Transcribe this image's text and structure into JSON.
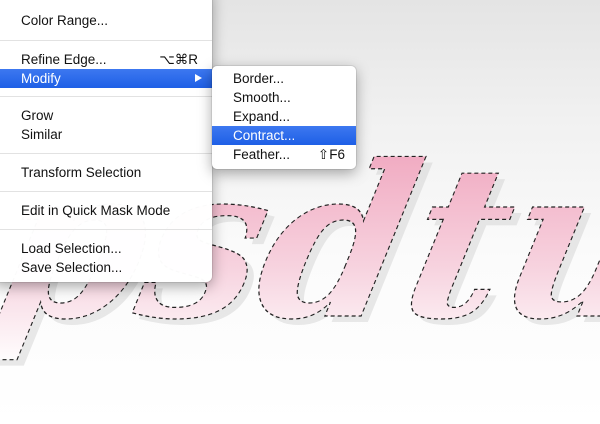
{
  "canvas": {
    "text": "psdtuts",
    "text_color": "#f3c6d3"
  },
  "menu": {
    "items": [
      {
        "label": "Color Range...",
        "shortcut": ""
      },
      {
        "label": "Refine Edge...",
        "shortcut": "⌥⌘R"
      },
      {
        "label": "Modify",
        "shortcut": ""
      },
      {
        "label": "Grow",
        "shortcut": ""
      },
      {
        "label": "Similar",
        "shortcut": ""
      },
      {
        "label": "Transform Selection",
        "shortcut": ""
      },
      {
        "label": "Edit in Quick Mask Mode",
        "shortcut": ""
      },
      {
        "label": "Load Selection...",
        "shortcut": ""
      },
      {
        "label": "Save Selection...",
        "shortcut": ""
      }
    ],
    "highlighted": "Modify",
    "submenu_arrow_icon": "triangle-right-icon"
  },
  "submenu": {
    "items": [
      {
        "label": "Border...",
        "shortcut": ""
      },
      {
        "label": "Smooth...",
        "shortcut": ""
      },
      {
        "label": "Expand...",
        "shortcut": ""
      },
      {
        "label": "Contract...",
        "shortcut": ""
      },
      {
        "label": "Feather...",
        "shortcut": "⇧F6"
      }
    ],
    "highlighted": "Contract..."
  },
  "colors": {
    "highlight": "#2a66ea",
    "menu_bg": "#ffffff"
  }
}
